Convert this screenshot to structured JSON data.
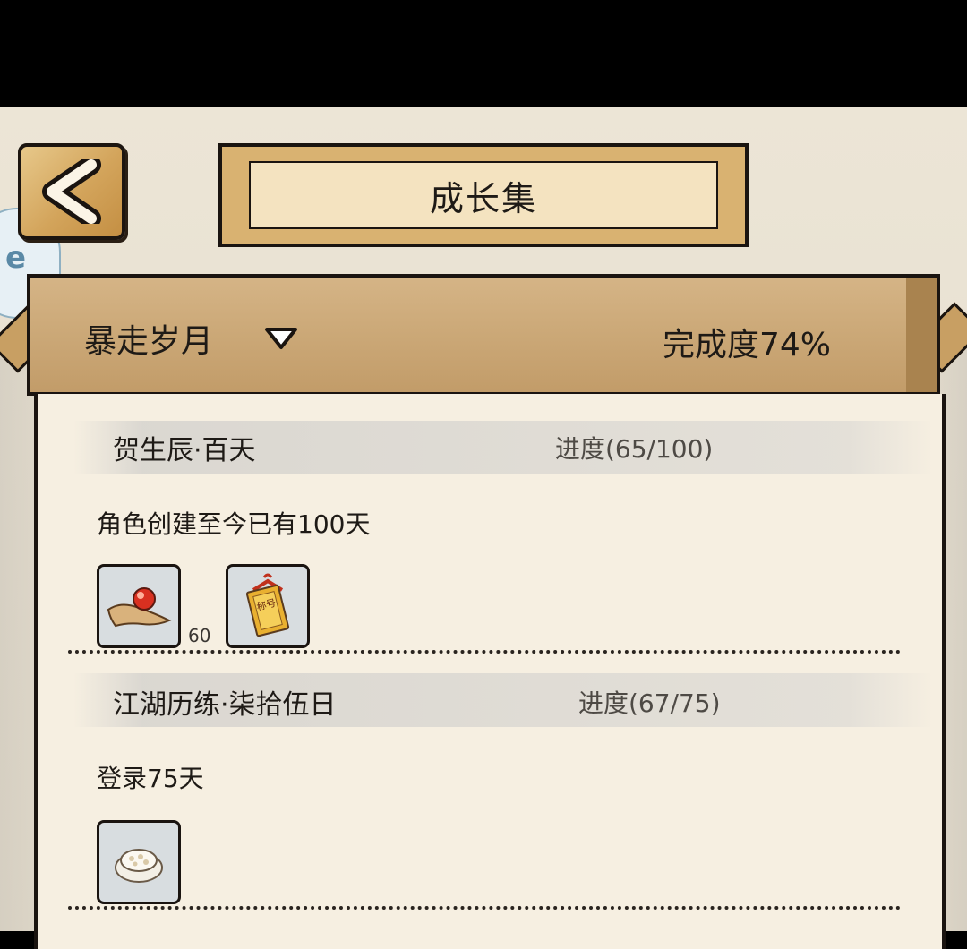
{
  "header": {
    "title": "成长集"
  },
  "side_badge": {
    "label": "e"
  },
  "group": {
    "label": "暴走岁月",
    "completion": "完成度74%"
  },
  "achievements": [
    {
      "title": "贺生辰·百天",
      "progress": "进度(65/100)",
      "description": "角色创建至今已有100天",
      "rewards": [
        {
          "icon": "pearl-on-cloth-icon",
          "count": "60"
        },
        {
          "icon": "title-scroll-icon",
          "label": "称号"
        }
      ]
    },
    {
      "title": "江湖历练·柒拾伍日",
      "progress": "进度(67/75)",
      "description": "登录75天",
      "rewards": [
        {
          "icon": "rice-cake-icon"
        }
      ]
    }
  ],
  "colors": {
    "background": "#e8e1d2",
    "banner": "#cba877",
    "panel": "#f6efe1",
    "outline": "#1a1410",
    "back_button": "#d3a45b"
  }
}
